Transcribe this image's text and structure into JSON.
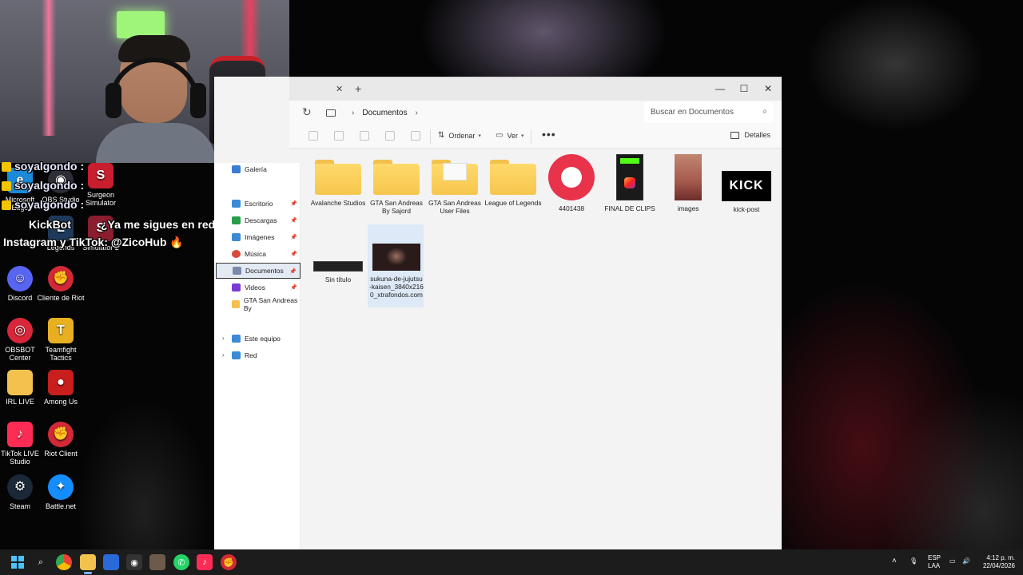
{
  "chat": {
    "lines": [
      {
        "user": "soyalgondo",
        "sep": ":"
      },
      {
        "user": "soyalgondo",
        "sep": ":"
      },
      {
        "user": "soyalgondo",
        "sep": ":"
      }
    ],
    "message_part1": "¿Ya me sigues en redes?",
    "message_part2": "Instagram y TikTok: @ZicoHub 🔥",
    "message_prefix": "KickBot"
  },
  "desktop": {
    "icons": [
      {
        "label": "Microsoft Edge",
        "color": "#1b8ad8",
        "icon": "edge-icon"
      },
      {
        "label": "OBS Studio",
        "color": "#2e2e38",
        "icon": "obs-icon"
      },
      {
        "label": "Surgeon Simulator",
        "color": "#c81e2e",
        "icon": "surgeon-icon"
      },
      {
        "label": "Legends",
        "color": "#1e3a5a",
        "icon": "lol-icon"
      },
      {
        "label": "Simulator 2",
        "color": "#8a1e2e",
        "icon": "surgeon2-icon"
      },
      {
        "label": "Discord",
        "color": "#5865f2",
        "icon": "discord-icon"
      },
      {
        "label": "Cliente de Riot",
        "color": "#d32936",
        "icon": "riot-icon"
      },
      {
        "label": "OBSBOT Center",
        "color": "#d8273a",
        "icon": "obsbot-icon"
      },
      {
        "label": "Teamfight Tactics",
        "color": "#e8b020",
        "icon": "tft-icon"
      },
      {
        "label": "IRL LIVE",
        "color": "#f2c14e",
        "icon": "folder-icon"
      },
      {
        "label": "Among Us",
        "color": "#c81e1e",
        "icon": "amongus-icon"
      },
      {
        "label": "TikTok LIVE Studio",
        "color": "#fe2c55",
        "icon": "tiktok-icon"
      },
      {
        "label": "Riot Client",
        "color": "#d32936",
        "icon": "riot-client-icon"
      },
      {
        "label": "Steam",
        "color": "#1b2838",
        "icon": "steam-icon"
      },
      {
        "label": "Battle.net",
        "color": "#148eff",
        "icon": "battlenet-icon"
      }
    ]
  },
  "explorer": {
    "tab_close": "✕",
    "tab_new": "+",
    "window": {
      "minimize": "—",
      "maximize": "☐",
      "close": "✕"
    },
    "breadcrumb": {
      "current": "Documentos"
    },
    "search": {
      "placeholder": "Buscar en Documentos"
    },
    "toolbar": {
      "sort_label": "Ordenar",
      "view_label": "Ver",
      "details_label": "Detalles",
      "more": "•••"
    },
    "nav": {
      "items": [
        {
          "label": "Galería",
          "color": "#3a7bd5"
        },
        {
          "label": "Escritorio",
          "color": "#3a8ad8"
        },
        {
          "label": "Descargas",
          "color": "#2a9d4a"
        },
        {
          "label": "Imágenes",
          "color": "#3a8ad8"
        },
        {
          "label": "Música",
          "color": "#d84a3a"
        },
        {
          "label": "Documentos",
          "color": "#7a8aa8"
        },
        {
          "label": "Videos",
          "color": "#7a3ad8"
        },
        {
          "label": "GTA San Andreas By",
          "color": "#f2c14e"
        },
        {
          "label": "Este equipo",
          "color": "#3a8ad8"
        },
        {
          "label": "Red",
          "color": "#3a8ad8"
        }
      ]
    },
    "files": [
      {
        "name": "Avalanche Studios",
        "kind": "folder"
      },
      {
        "name": "GTA San Andreas By Sajord",
        "kind": "folder"
      },
      {
        "name": "GTA San Andreas User Files",
        "kind": "folder-doc"
      },
      {
        "name": "League of Legends",
        "kind": "folder"
      },
      {
        "name": "4401438",
        "kind": "image",
        "color": "#e8334a"
      },
      {
        "name": "FINAL DE CLIPS",
        "kind": "image",
        "color": "#1a1a1a"
      },
      {
        "name": "images",
        "kind": "image",
        "color": "#b8675a"
      },
      {
        "name": "kick-post",
        "kind": "image",
        "color": "#000000",
        "text": "KICK"
      },
      {
        "name": "Sin título",
        "kind": "image",
        "color": "#222222"
      },
      {
        "name": "sukuna-de-jujutsu-kaisen_3840x2160_xtrafondos.com",
        "kind": "image",
        "color": "#2a1a1a"
      }
    ]
  },
  "taskbar": {
    "tray": {
      "lang1": "ESP",
      "lang2": "LAA",
      "time": "4:12 p. m.",
      "date": "22/04/2026"
    }
  }
}
